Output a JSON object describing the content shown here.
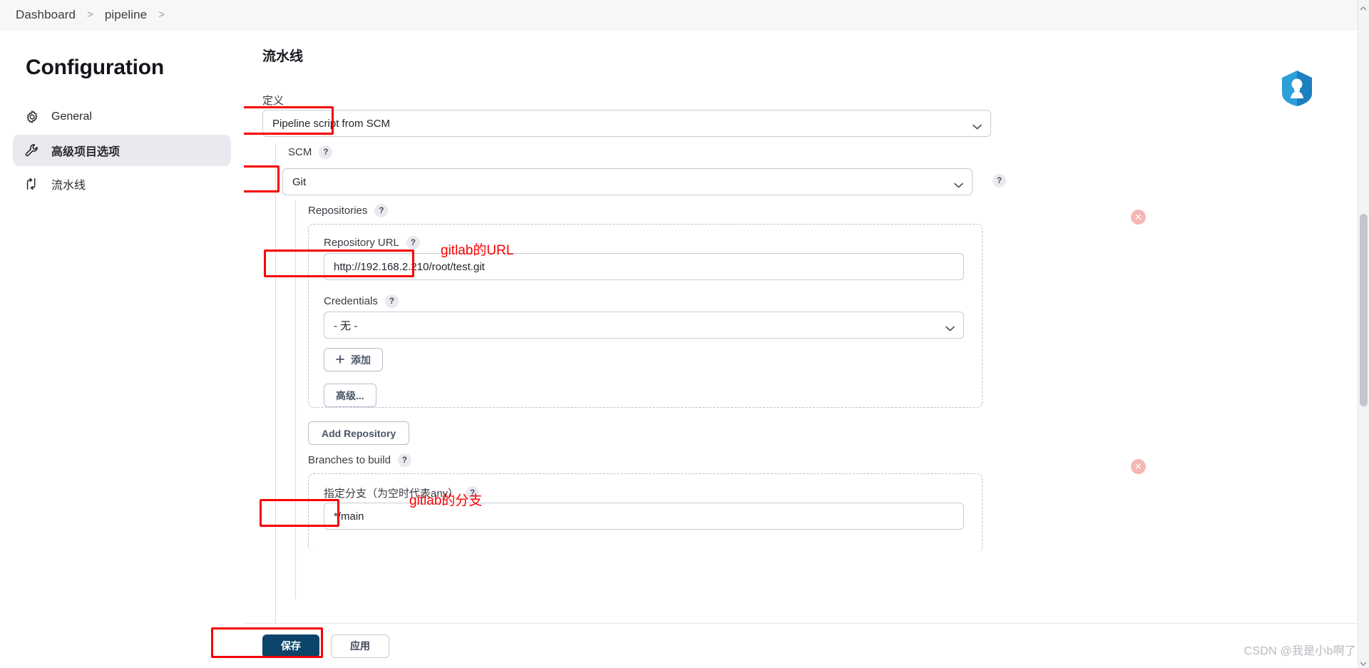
{
  "breadcrumb": {
    "items": [
      {
        "label": "Dashboard"
      },
      {
        "label": "pipeline"
      }
    ],
    "separator": ">"
  },
  "sidebar": {
    "title": "Configuration",
    "items": [
      {
        "label": "General",
        "icon": "gear-icon",
        "active": false
      },
      {
        "label": "高级项目选项",
        "icon": "wrench-icon",
        "active": true
      },
      {
        "label": "流水线",
        "icon": "pipeline-icon",
        "active": false
      }
    ]
  },
  "main": {
    "section_title": "流水线",
    "definition": {
      "label": "定义",
      "value": "Pipeline script from SCM"
    },
    "scm": {
      "label": "SCM",
      "help": "?",
      "value": "Git",
      "help_right": "?"
    },
    "repositories": {
      "label": "Repositories",
      "help": "?",
      "repository_url": {
        "label": "Repository URL",
        "help": "?",
        "value": "http://192.168.2.210/root/test.git"
      },
      "credentials": {
        "label": "Credentials",
        "help": "?",
        "value": "- 无 -",
        "add_button": "添加",
        "add_icon": "plus-icon"
      },
      "advanced_button": "高级...",
      "delete_icon": "delete-circle-icon"
    },
    "add_repository_button": "Add Repository",
    "branches": {
      "label": "Branches to build",
      "help": "?",
      "specifier": {
        "label": "指定分支（为空时代表any）",
        "help": "?",
        "value": "*/main"
      },
      "delete_icon": "delete-circle-icon"
    }
  },
  "annotations": {
    "url_note": "gitlab的URL",
    "branch_note": "gitlab的分支"
  },
  "bottom_bar": {
    "save": "保存",
    "apply": "应用"
  },
  "watermark": "CSDN @我是小b啊了",
  "colors": {
    "accent": "#0b4569",
    "annotation": "#fb0000",
    "sidebar_active": "#e9eaef"
  }
}
